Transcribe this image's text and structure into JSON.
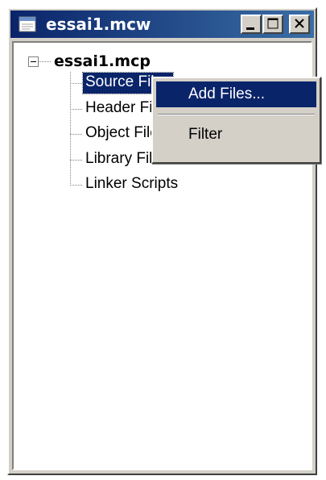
{
  "window": {
    "title": "essai1.mcw"
  },
  "tree": {
    "root_label": "essai1.mcp",
    "items": [
      {
        "label": "Source Files",
        "selected": true
      },
      {
        "label": "Header Files",
        "selected": false
      },
      {
        "label": "Object Files",
        "selected": false
      },
      {
        "label": "Library Files",
        "selected": false
      },
      {
        "label": "Linker Scripts",
        "selected": false
      }
    ]
  },
  "context_menu": {
    "items": [
      {
        "label": "Add Files...",
        "highlighted": true
      },
      {
        "label": "Filter",
        "highlighted": false
      }
    ]
  },
  "colors": {
    "titlebar_start": "#0a246a",
    "titlebar_end": "#3a6ea5",
    "selection": "#0a246a",
    "face": "#d4d0c8"
  },
  "icons": [
    "window-icon",
    "minimize-icon",
    "maximize-icon",
    "close-icon",
    "collapse-icon"
  ]
}
